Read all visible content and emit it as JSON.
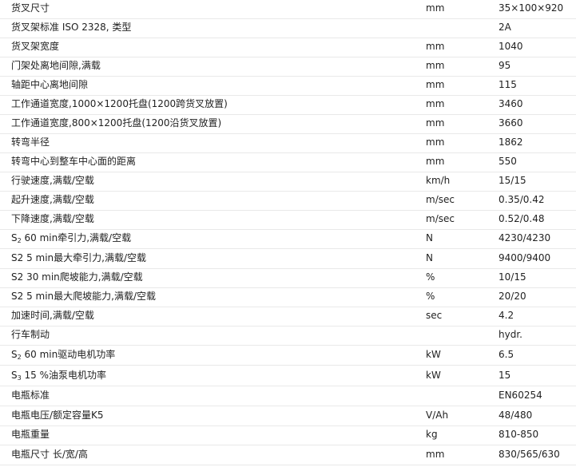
{
  "rows": [
    {
      "label": "货叉尺寸",
      "unit": "mm",
      "value": "35×100×920"
    },
    {
      "label": "货叉架标准 ISO 2328, 类型",
      "unit": "",
      "value": "2A"
    },
    {
      "label": "货叉架宽度",
      "unit": "mm",
      "value": "1040"
    },
    {
      "label": "门架处离地间隙,满载",
      "unit": "mm",
      "value": "95"
    },
    {
      "label": "轴距中心离地间隙",
      "unit": "mm",
      "value": "115"
    },
    {
      "label": "工作通道宽度,1000×1200托盘(1200跨货叉放置)",
      "unit": "mm",
      "value": "3460"
    },
    {
      "label": "工作通道宽度,800×1200托盘(1200沿货叉放置)",
      "unit": "mm",
      "value": "3660"
    },
    {
      "label": "转弯半径",
      "unit": "mm",
      "value": "1862"
    },
    {
      "label": "转弯中心到整车中心面的距离",
      "unit": "mm",
      "value": "550"
    },
    {
      "label": "行驶速度,满载/空载",
      "unit": "km/h",
      "value": "15/15"
    },
    {
      "label": "起升速度,满载/空载",
      "unit": "m/sec",
      "value": "0.35/0.42"
    },
    {
      "label": "下降速度,满载/空载",
      "unit": "m/sec",
      "value": "0.52/0.48"
    },
    {
      "label_prefix": "S",
      "label_sub": "2",
      "label": " 60 min牵引力,满载/空载",
      "unit": "N",
      "value": "4230/4230"
    },
    {
      "label": "S2 5 min最大牵引力,满载/空载",
      "unit": "N",
      "value": "9400/9400"
    },
    {
      "label": "S2 30 min爬坡能力,满载/空载",
      "unit": "%",
      "value": "10/15"
    },
    {
      "label": "S2 5 min最大爬坡能力,满载/空载",
      "unit": "%",
      "value": "20/20"
    },
    {
      "label": "加速时间,满载/空载",
      "unit": "sec",
      "value": "4.2"
    },
    {
      "label": "行车制动",
      "unit": "",
      "value": "hydr."
    },
    {
      "label_prefix": "S",
      "label_sub": "2",
      "label": " 60 min驱动电机功率",
      "unit": "kW",
      "value": "6.5"
    },
    {
      "label_prefix": "S",
      "label_sub": "3",
      "label": " 15 %油泵电机功率",
      "unit": "kW",
      "value": "15"
    },
    {
      "label": "电瓶标准",
      "unit": "",
      "value": "EN60254"
    },
    {
      "label": "电瓶电压/额定容量K5",
      "unit": "V/Ah",
      "value": "48/480"
    },
    {
      "label": "电瓶重量",
      "unit": "kg",
      "value": "810-850"
    },
    {
      "label": "电瓶尺寸 长/宽/高",
      "unit": "mm",
      "value": "830/565/630"
    }
  ]
}
